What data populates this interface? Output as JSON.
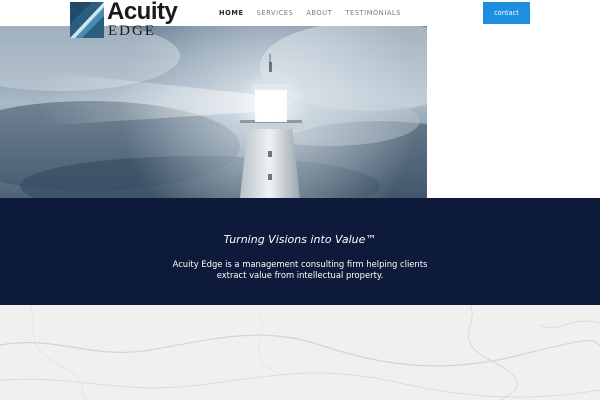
{
  "logo": {
    "word": "Acuity",
    "sub": "EDGE"
  },
  "nav": {
    "items": [
      "HOME",
      "SERVICES",
      "ABOUT",
      "TESTIMONIALS"
    ],
    "active": "HOME"
  },
  "header": {
    "contact_label": "contact"
  },
  "band": {
    "tagline": "Turning Visions into Value™",
    "description": "Acuity Edge is a management consulting firm helping clients extract value from intellectual property."
  },
  "colors": {
    "accent": "#1e8fe0",
    "band": "#0d1a3a"
  },
  "icons": {
    "logo_mark": "blue-diagonal-square-logo"
  }
}
